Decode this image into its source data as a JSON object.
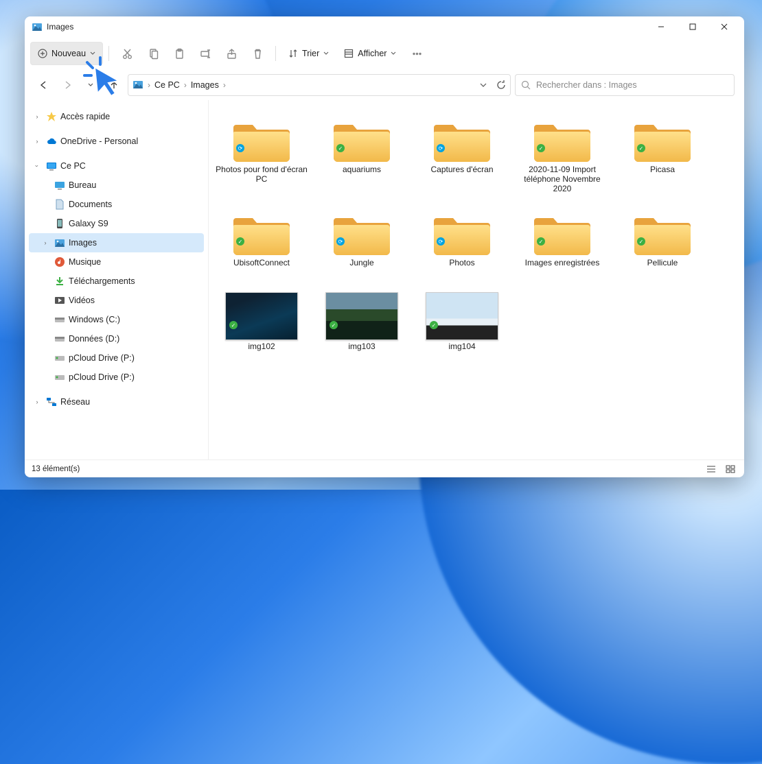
{
  "window": {
    "title": "Images"
  },
  "toolbar": {
    "new_label": "Nouveau",
    "sort_label": "Trier",
    "view_label": "Afficher"
  },
  "breadcrumb": {
    "root": "Ce PC",
    "current": "Images"
  },
  "search": {
    "placeholder": "Rechercher dans : Images"
  },
  "sidebar": {
    "quick_access": "Accès rapide",
    "onedrive": "OneDrive - Personal",
    "this_pc": "Ce PC",
    "children": [
      {
        "label": "Bureau"
      },
      {
        "label": "Documents"
      },
      {
        "label": "Galaxy S9"
      },
      {
        "label": "Images"
      },
      {
        "label": "Musique"
      },
      {
        "label": "Téléchargements"
      },
      {
        "label": "Vidéos"
      },
      {
        "label": "Windows (C:)"
      },
      {
        "label": "Données (D:)"
      },
      {
        "label": "pCloud Drive (P:)"
      },
      {
        "label": "pCloud Drive (P:)"
      }
    ],
    "network": "Réseau"
  },
  "items": [
    {
      "name": "Photos pour fond d'écran PC",
      "type": "folder",
      "status": "sync"
    },
    {
      "name": "aquariums",
      "type": "folder",
      "status": "ok"
    },
    {
      "name": "Captures d'écran",
      "type": "folder",
      "status": "sync"
    },
    {
      "name": "2020-11-09 Import téléphone Novembre 2020",
      "type": "folder",
      "status": "ok"
    },
    {
      "name": "Picasa",
      "type": "folder",
      "status": "ok"
    },
    {
      "name": "UbisoftConnect",
      "type": "folder",
      "status": "ok"
    },
    {
      "name": "Jungle",
      "type": "folder",
      "status": "sync"
    },
    {
      "name": "Photos",
      "type": "folder",
      "status": "sync"
    },
    {
      "name": "Images enregistrées",
      "type": "folder",
      "status": "ok"
    },
    {
      "name": "Pellicule",
      "type": "folder",
      "status": "ok"
    },
    {
      "name": "img102",
      "type": "image",
      "thumb": "t1",
      "status": "ok"
    },
    {
      "name": "img103",
      "type": "image",
      "thumb": "t2",
      "status": "ok"
    },
    {
      "name": "img104",
      "type": "image",
      "thumb": "t3",
      "status": "ok"
    }
  ],
  "status": {
    "count_text": "13 élément(s)"
  }
}
